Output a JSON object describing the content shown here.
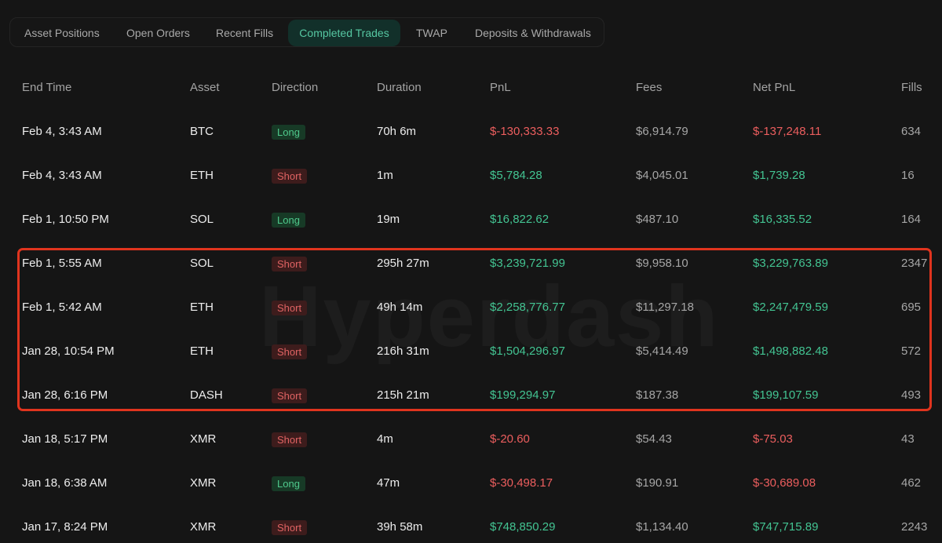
{
  "tabs": [
    {
      "label": "Asset Positions",
      "active": false
    },
    {
      "label": "Open Orders",
      "active": false
    },
    {
      "label": "Recent Fills",
      "active": false
    },
    {
      "label": "Completed Trades",
      "active": true
    },
    {
      "label": "TWAP",
      "active": false
    },
    {
      "label": "Deposits & Withdrawals",
      "active": false
    }
  ],
  "watermark": "Hyperdash",
  "columns": {
    "end_time": "End Time",
    "asset": "Asset",
    "direction": "Direction",
    "duration": "Duration",
    "pnl": "PnL",
    "fees": "Fees",
    "net_pnl": "Net PnL",
    "fills": "Fills"
  },
  "rows": [
    {
      "end_time": "Feb 4, 3:43 AM",
      "asset": "BTC",
      "direction": "Long",
      "duration": "70h 6m",
      "pnl": "$-130,333.33",
      "fees": "$6,914.79",
      "net_pnl": "$-137,248.11",
      "fills": "634"
    },
    {
      "end_time": "Feb 4, 3:43 AM",
      "asset": "ETH",
      "direction": "Short",
      "duration": "1m",
      "pnl": "$5,784.28",
      "fees": "$4,045.01",
      "net_pnl": "$1,739.28",
      "fills": "16"
    },
    {
      "end_time": "Feb 1, 10:50 PM",
      "asset": "SOL",
      "direction": "Long",
      "duration": "19m",
      "pnl": "$16,822.62",
      "fees": "$487.10",
      "net_pnl": "$16,335.52",
      "fills": "164"
    },
    {
      "end_time": "Feb 1, 5:55 AM",
      "asset": "SOL",
      "direction": "Short",
      "duration": "295h 27m",
      "pnl": "$3,239,721.99",
      "fees": "$9,958.10",
      "net_pnl": "$3,229,763.89",
      "fills": "2347"
    },
    {
      "end_time": "Feb 1, 5:42 AM",
      "asset": "ETH",
      "direction": "Short",
      "duration": "49h 14m",
      "pnl": "$2,258,776.77",
      "fees": "$11,297.18",
      "net_pnl": "$2,247,479.59",
      "fills": "695"
    },
    {
      "end_time": "Jan 28, 10:54 PM",
      "asset": "ETH",
      "direction": "Short",
      "duration": "216h 31m",
      "pnl": "$1,504,296.97",
      "fees": "$5,414.49",
      "net_pnl": "$1,498,882.48",
      "fills": "572"
    },
    {
      "end_time": "Jan 28, 6:16 PM",
      "asset": "DASH",
      "direction": "Short",
      "duration": "215h 21m",
      "pnl": "$199,294.97",
      "fees": "$187.38",
      "net_pnl": "$199,107.59",
      "fills": "493"
    },
    {
      "end_time": "Jan 18, 5:17 PM",
      "asset": "XMR",
      "direction": "Short",
      "duration": "4m",
      "pnl": "$-20.60",
      "fees": "$54.43",
      "net_pnl": "$-75.03",
      "fills": "43"
    },
    {
      "end_time": "Jan 18, 6:38 AM",
      "asset": "XMR",
      "direction": "Long",
      "duration": "47m",
      "pnl": "$-30,498.17",
      "fees": "$190.91",
      "net_pnl": "$-30,689.08",
      "fills": "462"
    },
    {
      "end_time": "Jan 17, 8:24 PM",
      "asset": "XMR",
      "direction": "Short",
      "duration": "39h 58m",
      "pnl": "$748,850.29",
      "fees": "$1,134.40",
      "net_pnl": "$747,715.89",
      "fills": "2243"
    }
  ],
  "colors": {
    "positive": "#43c492",
    "negative": "#ec5e5e",
    "accent_tab": "#56c7a2",
    "highlight_border": "#e0341e"
  }
}
